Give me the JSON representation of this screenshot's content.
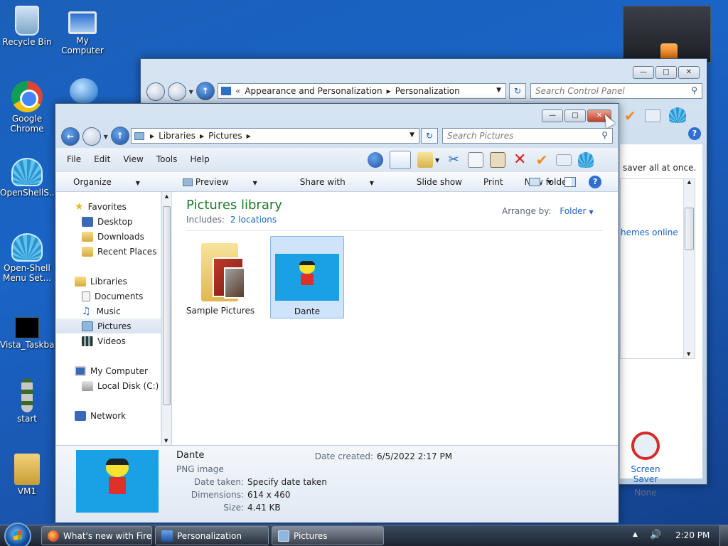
{
  "desktop": {
    "icons": [
      {
        "label": "Recycle Bin"
      },
      {
        "label": "My Computer"
      },
      {
        "label": "Google Chrome"
      },
      {
        "label": "OpenShellS..."
      },
      {
        "label": "Open-Shell Menu Set..."
      },
      {
        "label": "Vista_Taskbar"
      },
      {
        "label": "start"
      },
      {
        "label": "VM1"
      }
    ]
  },
  "personalization": {
    "breadcrumb": [
      "Appearance and Personalization",
      "Personalization"
    ],
    "search_placeholder": "Search Control Panel",
    "partial_text": "saver all at once.",
    "link_text": "hemes online",
    "screen_saver_label": "Screen Saver",
    "screen_saver_value": "None"
  },
  "explorer": {
    "breadcrumb": [
      "Libraries",
      "Pictures"
    ],
    "search_placeholder": "Search Pictures",
    "menu": [
      "File",
      "Edit",
      "View",
      "Tools",
      "Help"
    ],
    "commands": {
      "organize": "Organize",
      "preview": "Preview",
      "share": "Share with",
      "slideshow": "Slide show",
      "print": "Print",
      "newfolder": "New folder"
    },
    "nav": {
      "favorites": "Favorites",
      "desktop": "Desktop",
      "downloads": "Downloads",
      "recent": "Recent Places",
      "libraries": "Libraries",
      "documents": "Documents",
      "music": "Music",
      "pictures": "Pictures",
      "videos": "Videos",
      "mycomputer": "My Computer",
      "localdisk": "Local Disk (C:)",
      "network": "Network"
    },
    "library": {
      "title": "Pictures library",
      "includes_label": "Includes:",
      "includes_link": "2 locations",
      "arrange_label": "Arrange by:",
      "arrange_value": "Folder"
    },
    "items": [
      {
        "label": "Sample Pictures",
        "selected": false
      },
      {
        "label": "Dante",
        "selected": true
      }
    ],
    "details": {
      "name": "Dante",
      "type": "PNG image",
      "date_taken_label": "Date taken:",
      "date_taken_value": "Specify date taken",
      "dimensions_label": "Dimensions:",
      "dimensions_value": "614 x 460",
      "size_label": "Size:",
      "size_value": "4.41 KB",
      "created_label": "Date created:",
      "created_value": "6/5/2022 2:17 PM"
    }
  },
  "taskbar": {
    "buttons": [
      {
        "label": "What's new with Fire..."
      },
      {
        "label": "Personalization"
      },
      {
        "label": "Pictures"
      }
    ],
    "clock": "2:20 PM",
    "tray_up": "▲",
    "volume": "🔊"
  },
  "colors": {
    "accent": "#1f5fb5",
    "link": "#1a63c7",
    "library_title": "#1e7a2a",
    "selection": "#cfe3fb"
  }
}
